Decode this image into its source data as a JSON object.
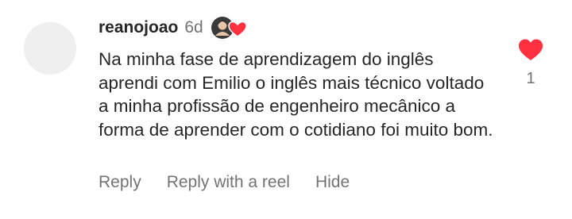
{
  "comment": {
    "username": "reanojoao",
    "timestamp": "6d",
    "text": "Na minha fase de aprendizagem do inglês aprendi com Emilio o inglês mais técnico voltado a minha profissão de engenheiro mecânico a forma de aprender com o cotidiano foi muito bom.",
    "actions": {
      "reply": "Reply",
      "reply_with_reel": "Reply with a reel",
      "hide": "Hide"
    },
    "like_count": "1",
    "colors": {
      "heart": "#ff3040",
      "text": "#262626",
      "secondary": "#737373",
      "avatar_placeholder": "#efefef"
    }
  }
}
